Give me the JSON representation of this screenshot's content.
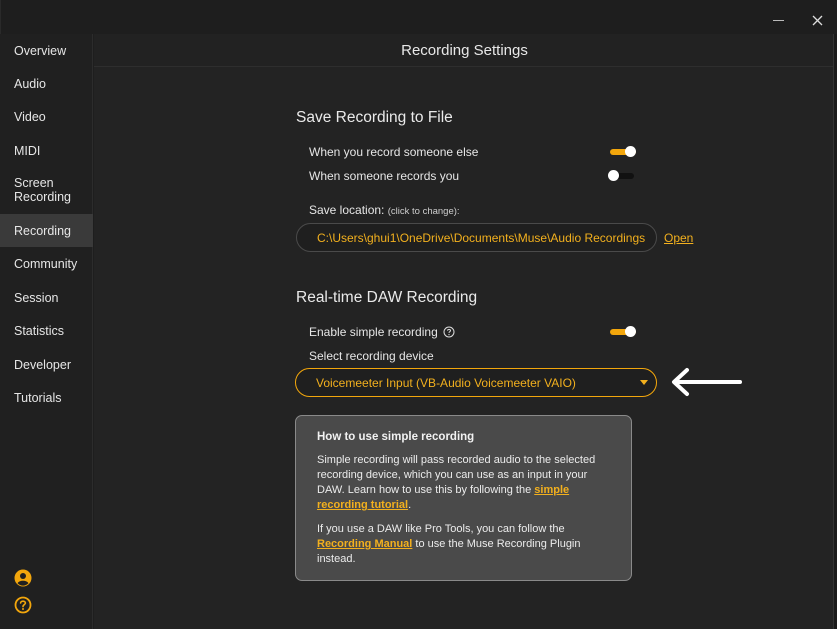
{
  "window": {
    "minimize_icon": "minimize-icon",
    "close_icon": "close-icon"
  },
  "sidebar": {
    "items": [
      {
        "label": "Overview"
      },
      {
        "label": "Audio"
      },
      {
        "label": "Video"
      },
      {
        "label": "MIDI"
      },
      {
        "label": "Screen Recording"
      },
      {
        "label": "Recording",
        "active": true
      },
      {
        "label": "Community"
      },
      {
        "label": "Session"
      },
      {
        "label": "Statistics"
      },
      {
        "label": "Developer"
      },
      {
        "label": "Tutorials"
      }
    ],
    "bottom_icons": [
      "account-icon",
      "help-icon"
    ]
  },
  "page": {
    "title": "Recording Settings"
  },
  "save_section": {
    "title": "Save Recording to File",
    "record_else_label": "When you record someone else",
    "record_else_on": true,
    "records_you_label": "When someone records you",
    "records_you_on": false,
    "location_label": "Save location:",
    "location_hint": "(click to change):",
    "location_path": "C:\\Users\\ghui1\\OneDrive\\Documents\\Muse\\Audio Recordings",
    "open_link": "Open"
  },
  "daw_section": {
    "title": "Real-time DAW Recording",
    "simple_label": "Enable simple recording",
    "simple_on": true,
    "device_label": "Select recording device",
    "device_value": "Voicemeeter Input (VB-Audio Voicemeeter VAIO)"
  },
  "help": {
    "title": "How to use simple recording",
    "para1_text": "Simple recording will pass recorded audio to the selected recording device, which you can use as an input in your DAW. Learn how to use this by following the ",
    "para1_link": "simple recording tutorial",
    "para1_end": ".",
    "para2_text": "If you use a DAW like Pro Tools, you can follow the ",
    "para2_link": "Recording Manual",
    "para2_end": " to use the Muse Recording Plugin instead."
  },
  "colors": {
    "accent": "#f2a60c",
    "background": "#232323",
    "sidebar": "#202020"
  }
}
